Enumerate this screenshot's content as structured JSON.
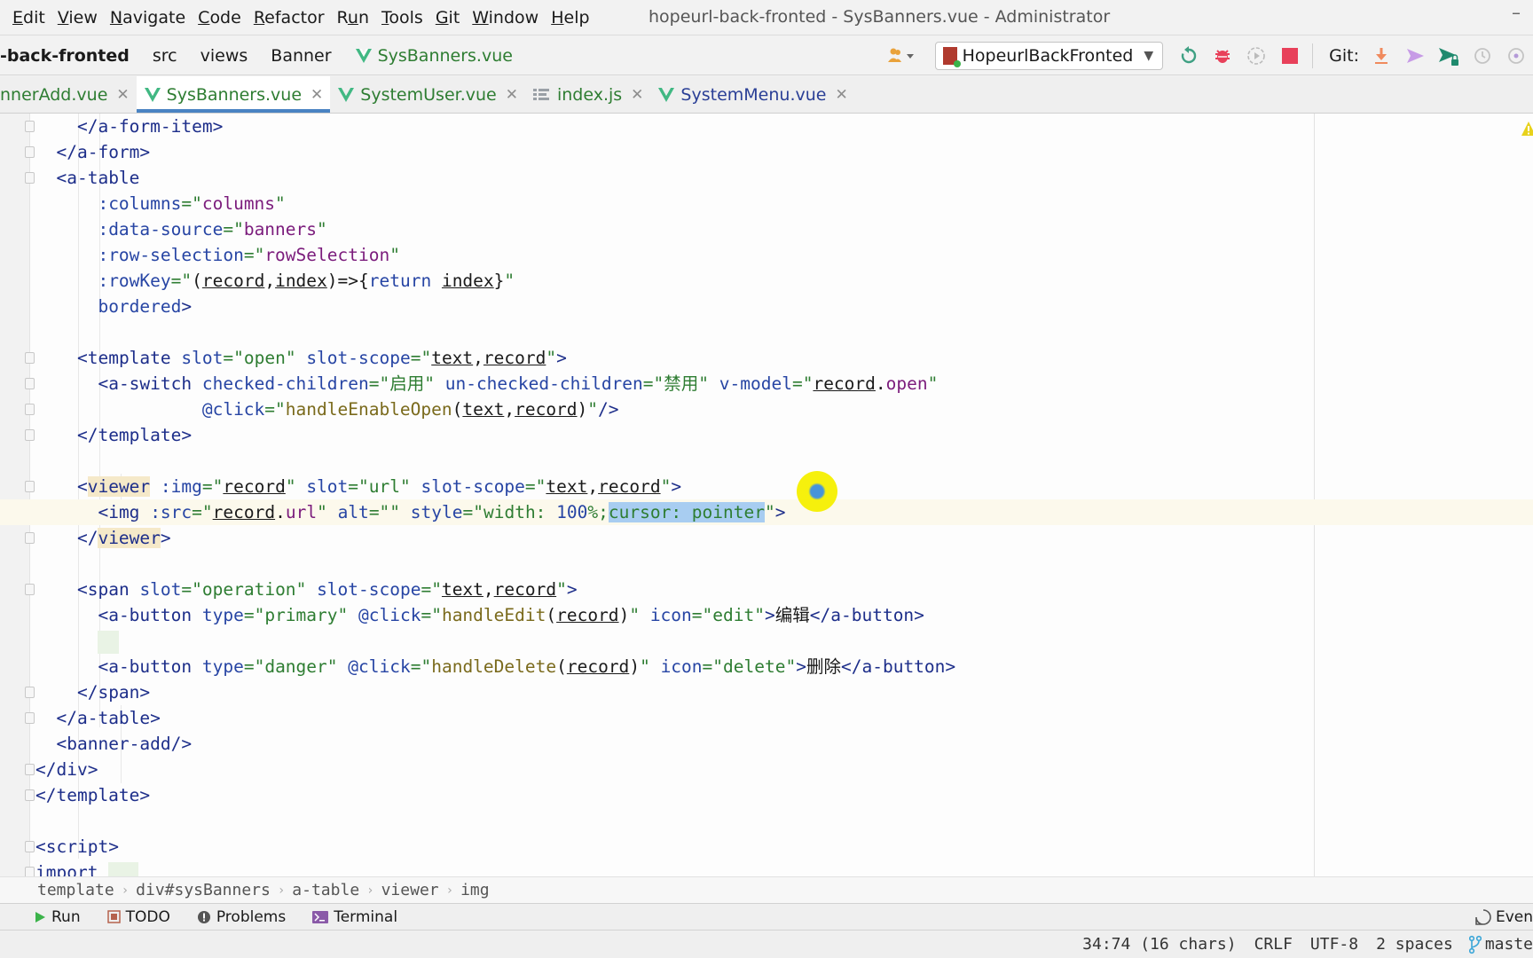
{
  "menu": {
    "items": [
      {
        "label": "Edit",
        "mnemonic": "E"
      },
      {
        "label": "View",
        "mnemonic": "V"
      },
      {
        "label": "Navigate",
        "mnemonic": "N"
      },
      {
        "label": "Code",
        "mnemonic": "C"
      },
      {
        "label": "Refactor",
        "mnemonic": "R"
      },
      {
        "label": "Run",
        "mnemonic": "u"
      },
      {
        "label": "Tools",
        "mnemonic": "T"
      },
      {
        "label": "Git",
        "mnemonic": "G"
      },
      {
        "label": "Window",
        "mnemonic": "W"
      },
      {
        "label": "Help",
        "mnemonic": "H"
      }
    ],
    "window_title": "hopeurl-back-fronted - SysBanners.vue - Administrator",
    "minimize": "–"
  },
  "navbar": {
    "crumbs": [
      "-back-fronted",
      "src",
      "views",
      "Banner"
    ],
    "file": "SysBanners.vue",
    "run_config": "HopeurlBackFronted",
    "git_label": "Git:",
    "icons": [
      "users-icon",
      "rerun-icon",
      "debug-icon",
      "attach-icon",
      "stop-icon",
      "git-update-icon",
      "git-commit-icon",
      "git-push-icon",
      "history-icon",
      "rollback-icon"
    ]
  },
  "tabs": [
    {
      "label": "nnerAdd.vue",
      "icon": "vue",
      "active": false,
      "color": "#2e7d32"
    },
    {
      "label": "SysBanners.vue",
      "icon": "vue",
      "active": true,
      "color": "#2e7d32"
    },
    {
      "label": "SystemUser.vue",
      "icon": "vue",
      "active": false,
      "color": "#2e7d32"
    },
    {
      "label": "index.js",
      "icon": "js",
      "active": false,
      "color": "#2e7d32"
    },
    {
      "label": "SystemMenu.vue",
      "icon": "vue",
      "active": false,
      "color": "#2a3f96"
    }
  ],
  "code": {
    "lines": [
      "    </a-form-item>",
      "  </a-form>",
      "  <a-table",
      "      :columns=\"columns\"",
      "      :data-source=\"banners\"",
      "      :row-selection=\"rowSelection\"",
      "      :rowKey=\"(record,index)=>{return index}\"",
      "      bordered>",
      "",
      "    <template slot=\"open\" slot-scope=\"text,record\">",
      "      <a-switch checked-children=\"启用\" un-checked-children=\"禁用\" v-model=\"record.open\"",
      "                @click=\"handleEnableOpen(text,record)\"/>",
      "    </template>",
      "",
      "    <viewer :img=\"record\" slot=\"url\" slot-scope=\"text,record\">",
      "      <img :src=\"record.url\" alt=\"\" style=\"width: 100%;cursor: pointer\">",
      "    </viewer>",
      "",
      "    <span slot=\"operation\" slot-scope=\"text,record\">",
      "      <a-button type=\"primary\" @click=\"handleEdit(record)\" icon=\"edit\">编辑</a-button>",
      "",
      "      <a-button type=\"danger\" @click=\"handleDelete(record)\" icon=\"delete\">删除</a-button>",
      "    </span>",
      "  </a-table>",
      "  <banner-add/>",
      "</div>",
      "</template>",
      "",
      "<script>",
      "import ..."
    ],
    "selection": "cursor: pointer",
    "current_line_index": 15
  },
  "breadcrumbs": [
    "template",
    "div#sysBanners",
    "a-table",
    "viewer",
    "img"
  ],
  "tool_windows": [
    {
      "label": "Run",
      "icon": "run-icon"
    },
    {
      "label": "TODO",
      "icon": "todo-icon"
    },
    {
      "label": "Problems",
      "icon": "problems-icon"
    },
    {
      "label": "Terminal",
      "icon": "terminal-icon"
    }
  ],
  "event_log": "Even",
  "status": {
    "position": "34:74 (16 chars)",
    "line_sep": "CRLF",
    "encoding": "UTF-8",
    "indent": "2 spaces",
    "branch": "maste"
  },
  "colors": {
    "accent": "#4a83c3",
    "vue_green": "#41b883",
    "stop_red": "#e8405a",
    "selection": "#a8cdf1"
  }
}
